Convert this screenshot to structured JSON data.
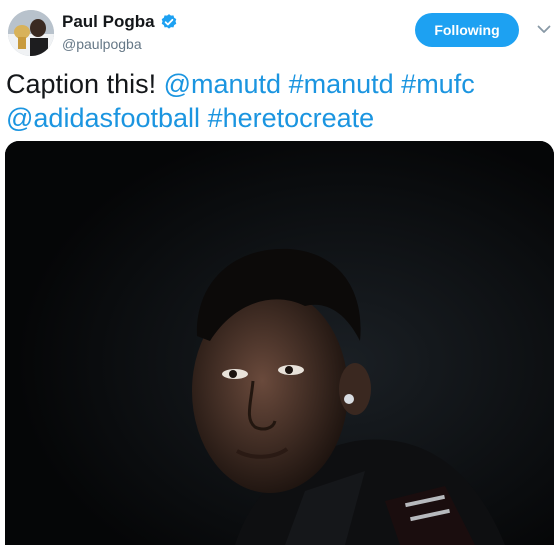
{
  "header": {
    "display_name": "Paul Pogba",
    "handle": "@paulpogba",
    "follow_label": "Following"
  },
  "tweet": {
    "text_prefix": "Caption this! ",
    "mentions_and_tags": [
      "@manutd",
      "#manutd",
      "#mufc",
      "@adidasfootball",
      "#heretocreate"
    ]
  },
  "icons": {
    "verified": "verified-badge-icon",
    "menu": "chevron-down-icon"
  },
  "colors": {
    "accent": "#1da1f2",
    "link": "#1b95e0",
    "text": "#14171a",
    "muted": "#657786",
    "media_bg": "#07090b"
  }
}
